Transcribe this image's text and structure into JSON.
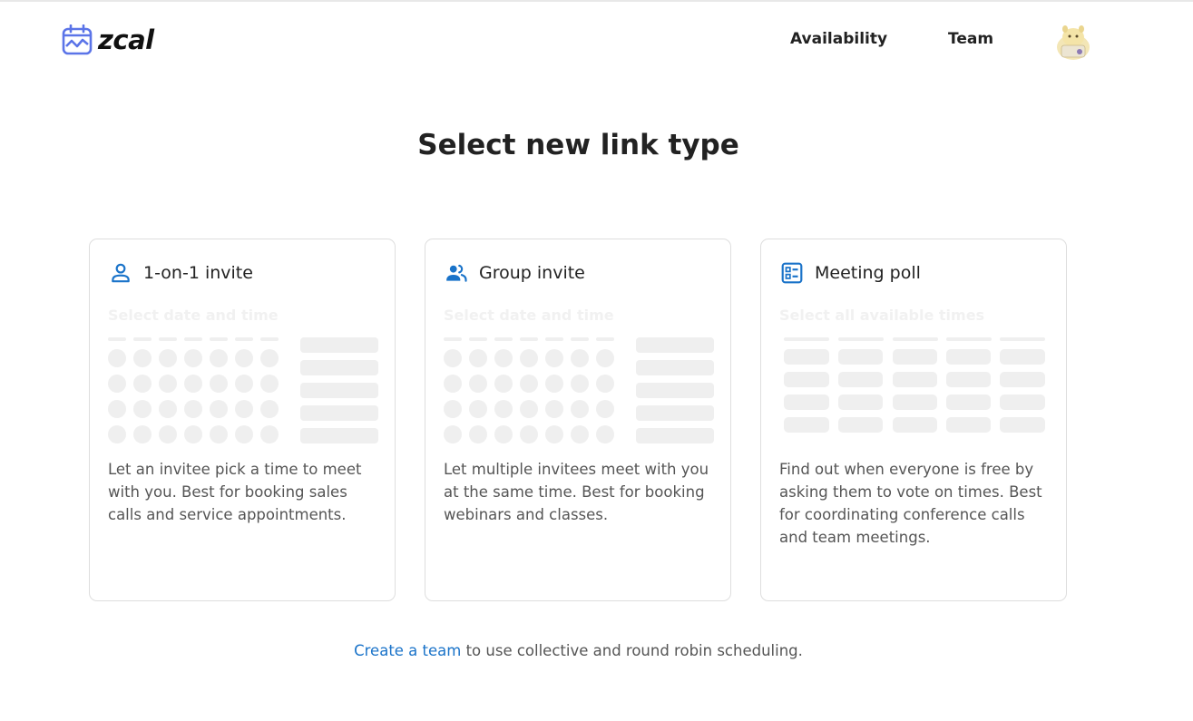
{
  "header": {
    "brand": "zcal",
    "nav": {
      "availability": "Availability",
      "team": "Team"
    }
  },
  "main": {
    "title": "Select new link type",
    "cards": [
      {
        "icon": "person-icon",
        "title": "1-on-1 invite",
        "preview_label": "Select date and time",
        "description": "Let an invitee pick a time to meet with you. Best for booking sales calls and service appointments."
      },
      {
        "icon": "group-icon",
        "title": "Group invite",
        "preview_label": "Select date and time",
        "description": "Let multiple invitees meet with you at the same time. Best for booking webinars and classes."
      },
      {
        "icon": "poll-icon",
        "title": "Meeting poll",
        "preview_label": "Select all available times",
        "description": "Find out when everyone is free by asking them to vote on times. Best for coordinating conference calls and team meetings."
      }
    ]
  },
  "footer": {
    "link": "Create a team",
    "text": " to use collective and round robin scheduling."
  },
  "colors": {
    "accent": "#1a73c9",
    "placeholder": "#eeeeee",
    "border": "#dedede"
  }
}
